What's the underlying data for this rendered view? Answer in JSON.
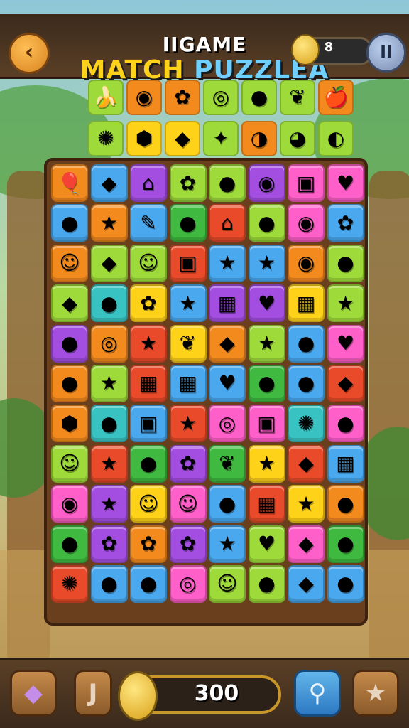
{
  "header": {
    "title_top": "IIGAME",
    "title_match": "MATCH",
    "title_puzzle": "PUZZLEA",
    "coins": "8",
    "back_icon": "‹",
    "pause_icon": "II"
  },
  "colors": {
    "red": "#e84a2a",
    "orange": "#f28a1e",
    "yellow": "#ffd21a",
    "lime": "#9edb3a",
    "green": "#3fb93f",
    "blue": "#4aa8ee",
    "purple": "#a34ee0",
    "pink": "#ff5fc8",
    "teal": "#38c2c2"
  },
  "top_rows": [
    [
      {
        "c": "lime",
        "g": "🍌"
      },
      {
        "c": "orange",
        "g": "◉"
      },
      {
        "c": "orange",
        "g": "✿"
      },
      {
        "c": "lime",
        "g": "◎"
      },
      {
        "c": "lime",
        "g": "●"
      },
      {
        "c": "lime",
        "g": "❦"
      },
      {
        "c": "orange",
        "g": "🍎"
      }
    ],
    [
      {
        "c": "lime",
        "g": "✺"
      },
      {
        "c": "yellow",
        "g": "⬢"
      },
      {
        "c": "yellow",
        "g": "◆"
      },
      {
        "c": "lime",
        "g": "✦"
      },
      {
        "c": "orange",
        "g": "◑"
      },
      {
        "c": "lime",
        "g": "◕"
      },
      {
        "c": "lime",
        "g": "◐"
      }
    ]
  ],
  "board": [
    [
      {
        "c": "orange",
        "g": "🎈"
      },
      {
        "c": "blue",
        "g": "◆"
      },
      {
        "c": "purple",
        "g": "⌂"
      },
      {
        "c": "lime",
        "g": "✿"
      },
      {
        "c": "lime",
        "g": "●"
      },
      {
        "c": "purple",
        "g": "◉"
      },
      {
        "c": "pink",
        "g": "▣"
      },
      {
        "c": "pink",
        "g": "♥"
      }
    ],
    [
      {
        "c": "blue",
        "g": "●"
      },
      {
        "c": "orange",
        "g": "★"
      },
      {
        "c": "blue",
        "g": "✎"
      },
      {
        "c": "green",
        "g": "●"
      },
      {
        "c": "red",
        "g": "⌂"
      },
      {
        "c": "lime",
        "g": "●"
      },
      {
        "c": "pink",
        "g": "◉"
      },
      {
        "c": "blue",
        "g": "✿"
      }
    ],
    [
      {
        "c": "orange",
        "g": "☺"
      },
      {
        "c": "lime",
        "g": "◆"
      },
      {
        "c": "lime",
        "g": "☺"
      },
      {
        "c": "red",
        "g": "▣"
      },
      {
        "c": "blue",
        "g": "★"
      },
      {
        "c": "blue",
        "g": "★"
      },
      {
        "c": "orange",
        "g": "◉"
      },
      {
        "c": "lime",
        "g": "●"
      }
    ],
    [
      {
        "c": "lime",
        "g": "◆"
      },
      {
        "c": "teal",
        "g": "●"
      },
      {
        "c": "yellow",
        "g": "✿"
      },
      {
        "c": "blue",
        "g": "★"
      },
      {
        "c": "purple",
        "g": "▦"
      },
      {
        "c": "purple",
        "g": "♥"
      },
      {
        "c": "yellow",
        "g": "▦"
      },
      {
        "c": "lime",
        "g": "★"
      }
    ],
    [
      {
        "c": "purple",
        "g": "●"
      },
      {
        "c": "orange",
        "g": "◎"
      },
      {
        "c": "red",
        "g": "★"
      },
      {
        "c": "yellow",
        "g": "❦"
      },
      {
        "c": "orange",
        "g": "◆"
      },
      {
        "c": "lime",
        "g": "★"
      },
      {
        "c": "blue",
        "g": "●"
      },
      {
        "c": "pink",
        "g": "♥"
      }
    ],
    [
      {
        "c": "orange",
        "g": "●"
      },
      {
        "c": "lime",
        "g": "★"
      },
      {
        "c": "red",
        "g": "▦"
      },
      {
        "c": "blue",
        "g": "▦"
      },
      {
        "c": "blue",
        "g": "♥"
      },
      {
        "c": "green",
        "g": "●"
      },
      {
        "c": "blue",
        "g": "●"
      },
      {
        "c": "red",
        "g": "◆"
      }
    ],
    [
      {
        "c": "orange",
        "g": "⬢"
      },
      {
        "c": "teal",
        "g": "●"
      },
      {
        "c": "blue",
        "g": "▣"
      },
      {
        "c": "red",
        "g": "★"
      },
      {
        "c": "pink",
        "g": "◎"
      },
      {
        "c": "pink",
        "g": "▣"
      },
      {
        "c": "teal",
        "g": "✺"
      },
      {
        "c": "pink",
        "g": "●"
      }
    ],
    [
      {
        "c": "lime",
        "g": "☺"
      },
      {
        "c": "red",
        "g": "★"
      },
      {
        "c": "green",
        "g": "●"
      },
      {
        "c": "purple",
        "g": "✿"
      },
      {
        "c": "green",
        "g": "❦"
      },
      {
        "c": "yellow",
        "g": "★"
      },
      {
        "c": "red",
        "g": "◆"
      },
      {
        "c": "blue",
        "g": "▦"
      }
    ],
    [
      {
        "c": "pink",
        "g": "◉"
      },
      {
        "c": "purple",
        "g": "★"
      },
      {
        "c": "yellow",
        "g": "☺"
      },
      {
        "c": "pink",
        "g": "☺"
      },
      {
        "c": "blue",
        "g": "●"
      },
      {
        "c": "red",
        "g": "▦"
      },
      {
        "c": "yellow",
        "g": "★"
      },
      {
        "c": "orange",
        "g": "●"
      }
    ],
    [
      {
        "c": "green",
        "g": "●"
      },
      {
        "c": "purple",
        "g": "✿"
      },
      {
        "c": "orange",
        "g": "✿"
      },
      {
        "c": "purple",
        "g": "✿"
      },
      {
        "c": "blue",
        "g": "★"
      },
      {
        "c": "lime",
        "g": "♥"
      },
      {
        "c": "pink",
        "g": "◆"
      },
      {
        "c": "green",
        "g": "●"
      }
    ],
    [
      {
        "c": "red",
        "g": "✺"
      },
      {
        "c": "blue",
        "g": "●"
      },
      {
        "c": "blue",
        "g": "●"
      },
      {
        "c": "pink",
        "g": "◎"
      },
      {
        "c": "lime",
        "g": "☺"
      },
      {
        "c": "lime",
        "g": "●"
      },
      {
        "c": "blue",
        "g": "◆"
      },
      {
        "c": "blue",
        "g": "●"
      }
    ]
  ],
  "footer": {
    "score": "300",
    "gem_icon": "◆",
    "hook_icon": "J",
    "search_icon": "⚲",
    "star_icon": "★"
  }
}
